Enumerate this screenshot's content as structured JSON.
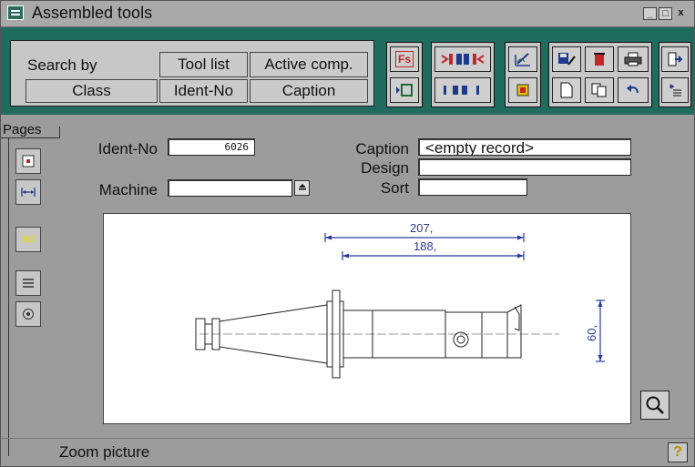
{
  "window": {
    "title": "Assembled tools",
    "minimize_label": "_",
    "maximize_label": "□",
    "close_label": "x"
  },
  "search": {
    "label": "Search by",
    "buttons": {
      "class": "Class",
      "tool_list": "Tool list",
      "ident_no": "Ident-No",
      "active_comp": "Active comp.",
      "caption": "Caption"
    }
  },
  "toolbar": {
    "fs_label": "Fs",
    "icons": [
      "fs-icon",
      "record-next-icon",
      "first-last-icon",
      "prev-next-icon",
      "edit-drawing-icon",
      "window-icon",
      "save-edit-icon",
      "delete-icon",
      "print-icon",
      "exit-icon",
      "new-document-icon",
      "copy-icon",
      "undo-icon",
      "options-icon"
    ]
  },
  "pages": {
    "label": "Pages",
    "ad_label": "AD"
  },
  "form": {
    "ident_no_label": "Ident-No",
    "ident_no_value": "6026",
    "caption_label": "Caption",
    "caption_value": "<empty record>",
    "design_label": "Design",
    "design_value": "",
    "machine_label": "Machine",
    "machine_value": "",
    "sort_label": "Sort",
    "sort_value": ""
  },
  "drawing": {
    "dim_overall": "207,",
    "dim_inner": "188,",
    "dim_diameter": "60,",
    "dim_color": "#2a3a9a"
  },
  "status": {
    "text": "Zoom picture",
    "help_label": "?"
  }
}
